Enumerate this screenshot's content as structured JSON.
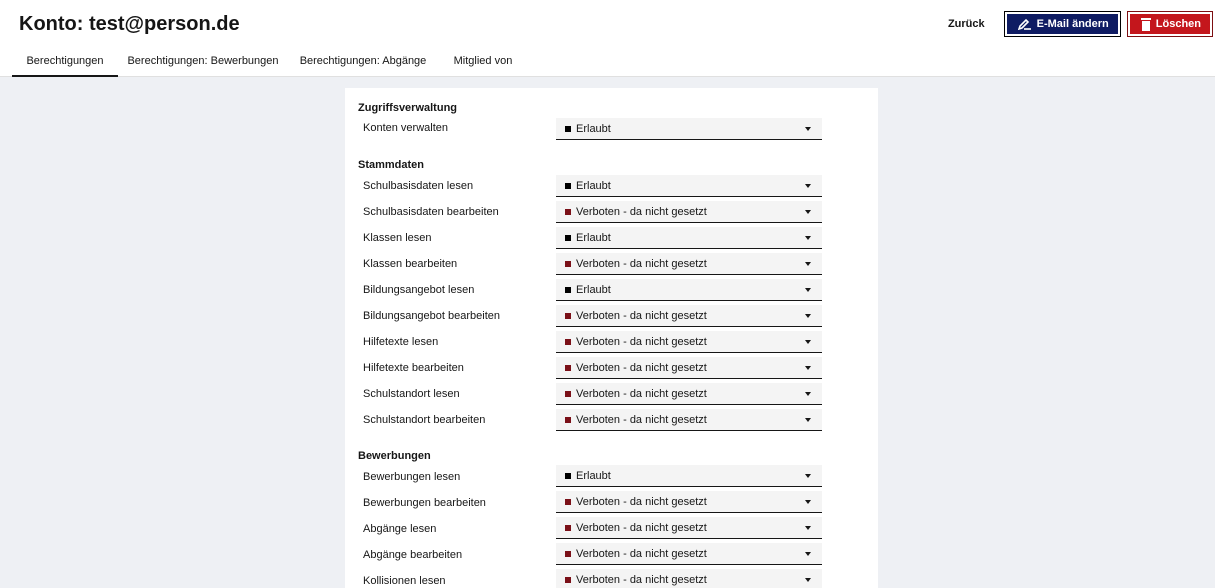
{
  "header": {
    "title": "Konto: test@person.de",
    "back_label": "Zurück",
    "edit_email_label": "E-Mail ändern",
    "delete_label": "Löschen"
  },
  "tabs": [
    {
      "label": "Berechtigungen",
      "active": true
    },
    {
      "label": "Berechtigungen: Bewerbungen",
      "active": false
    },
    {
      "label": "Berechtigungen: Abgänge",
      "active": false
    },
    {
      "label": "Mitglied von",
      "active": false
    }
  ],
  "colors": {
    "allowed": "#000000",
    "forbidden": "#7a1018",
    "edit_button": "#0f1c63",
    "delete_button": "#c4161c"
  },
  "sections": [
    {
      "title": "Zugriffsverwaltung",
      "rows": [
        {
          "label": "Konten verwalten",
          "value": "Erlaubt",
          "status": "allowed"
        }
      ]
    },
    {
      "title": "Stammdaten",
      "rows": [
        {
          "label": "Schulbasisdaten lesen",
          "value": "Erlaubt",
          "status": "allowed"
        },
        {
          "label": "Schulbasisdaten bearbeiten",
          "value": "Verboten - da nicht gesetzt",
          "status": "forbidden"
        },
        {
          "label": "Klassen lesen",
          "value": "Erlaubt",
          "status": "allowed"
        },
        {
          "label": "Klassen bearbeiten",
          "value": "Verboten - da nicht gesetzt",
          "status": "forbidden"
        },
        {
          "label": "Bildungsangebot lesen",
          "value": "Erlaubt",
          "status": "allowed"
        },
        {
          "label": "Bildungsangebot bearbeiten",
          "value": "Verboten - da nicht gesetzt",
          "status": "forbidden"
        },
        {
          "label": "Hilfetexte lesen",
          "value": "Verboten - da nicht gesetzt",
          "status": "forbidden"
        },
        {
          "label": "Hilfetexte bearbeiten",
          "value": "Verboten - da nicht gesetzt",
          "status": "forbidden"
        },
        {
          "label": "Schulstandort lesen",
          "value": "Verboten - da nicht gesetzt",
          "status": "forbidden"
        },
        {
          "label": "Schulstandort bearbeiten",
          "value": "Verboten - da nicht gesetzt",
          "status": "forbidden"
        }
      ]
    },
    {
      "title": "Bewerbungen",
      "rows": [
        {
          "label": "Bewerbungen lesen",
          "value": "Erlaubt",
          "status": "allowed"
        },
        {
          "label": "Bewerbungen bearbeiten",
          "value": "Verboten - da nicht gesetzt",
          "status": "forbidden"
        },
        {
          "label": "Abgänge lesen",
          "value": "Verboten - da nicht gesetzt",
          "status": "forbidden"
        },
        {
          "label": "Abgänge bearbeiten",
          "value": "Verboten - da nicht gesetzt",
          "status": "forbidden"
        },
        {
          "label": "Kollisionen lesen",
          "value": "Verboten - da nicht gesetzt",
          "status": "forbidden"
        }
      ]
    }
  ]
}
